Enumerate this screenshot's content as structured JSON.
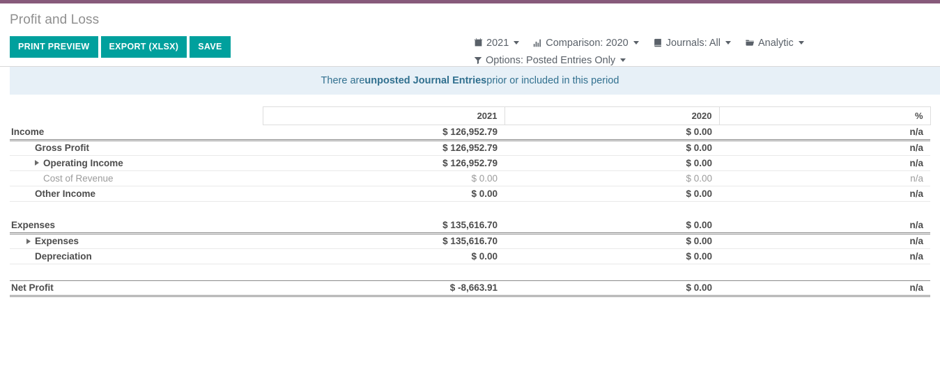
{
  "brand": {
    "top_bar_color": "#875A7B",
    "button_color": "#00A09D"
  },
  "header": {
    "title": "Profit and Loss",
    "buttons": [
      {
        "label": "PRINT PREVIEW",
        "name": "print-preview-button"
      },
      {
        "label": "EXPORT (XLSX)",
        "name": "export-xlsx-button"
      },
      {
        "label": "SAVE",
        "name": "save-button"
      }
    ]
  },
  "filters": {
    "row1": [
      {
        "icon": "calendar-icon",
        "label": "2021",
        "name": "date-filter"
      },
      {
        "icon": "bar-chart-icon",
        "label": "Comparison: 2020",
        "name": "comparison-filter"
      },
      {
        "icon": "book-icon",
        "label": "Journals: All",
        "name": "journals-filter"
      },
      {
        "icon": "folder-icon",
        "label": "Analytic",
        "name": "analytic-filter"
      }
    ],
    "row2": [
      {
        "icon": "funnel-icon",
        "label": "Options: Posted Entries Only",
        "name": "options-filter"
      }
    ]
  },
  "alert": {
    "prefix": "There are ",
    "strong": "unposted Journal Entries",
    "suffix": " prior or included in this period"
  },
  "table": {
    "columns": [
      "",
      "2021",
      "2020",
      "%"
    ],
    "rows": [
      {
        "label": "Income",
        "level": 0,
        "expandable": false,
        "muted": false,
        "v1": "$ 126,952.79",
        "v2": "$ 0.00",
        "v3": "n/a",
        "style": "dbl-under"
      },
      {
        "label": "Gross Profit",
        "level": 1,
        "expandable": false,
        "muted": false,
        "v1": "$ 126,952.79",
        "v2": "$ 0.00",
        "v3": "n/a",
        "style": ""
      },
      {
        "label": "Operating Income",
        "level": 2,
        "expandable": true,
        "muted": false,
        "v1": "$ 126,952.79",
        "v2": "$ 0.00",
        "v3": "n/a",
        "style": ""
      },
      {
        "label": "Cost of Revenue",
        "level": 2,
        "expandable": false,
        "muted": true,
        "v1": "$ 0.00",
        "v2": "$ 0.00",
        "v3": "n/a",
        "style": ""
      },
      {
        "label": "Other Income",
        "level": 1,
        "expandable": false,
        "muted": false,
        "v1": "$ 0.00",
        "v2": "$ 0.00",
        "v3": "n/a",
        "style": ""
      },
      {
        "label": "",
        "level": 0,
        "expandable": false,
        "muted": false,
        "v1": "",
        "v2": "",
        "v3": "",
        "style": "spacer"
      },
      {
        "label": "Expenses",
        "level": 0,
        "expandable": false,
        "muted": false,
        "v1": "$ 135,616.70",
        "v2": "$ 0.00",
        "v3": "n/a",
        "style": "dbl-under"
      },
      {
        "label": "Expenses",
        "level": 1,
        "expandable": true,
        "muted": false,
        "v1": "$ 135,616.70",
        "v2": "$ 0.00",
        "v3": "n/a",
        "style": ""
      },
      {
        "label": "Depreciation",
        "level": 1,
        "expandable": false,
        "muted": false,
        "v1": "$ 0.00",
        "v2": "$ 0.00",
        "v3": "n/a",
        "style": ""
      },
      {
        "label": "",
        "level": 0,
        "expandable": false,
        "muted": false,
        "v1": "",
        "v2": "",
        "v3": "",
        "style": "spacer"
      },
      {
        "label": "Net Profit",
        "level": 0,
        "expandable": false,
        "muted": false,
        "v1": "$ -8,663.91",
        "v2": "$ 0.00",
        "v3": "n/a",
        "style": "dbl-under top-rule"
      }
    ]
  }
}
